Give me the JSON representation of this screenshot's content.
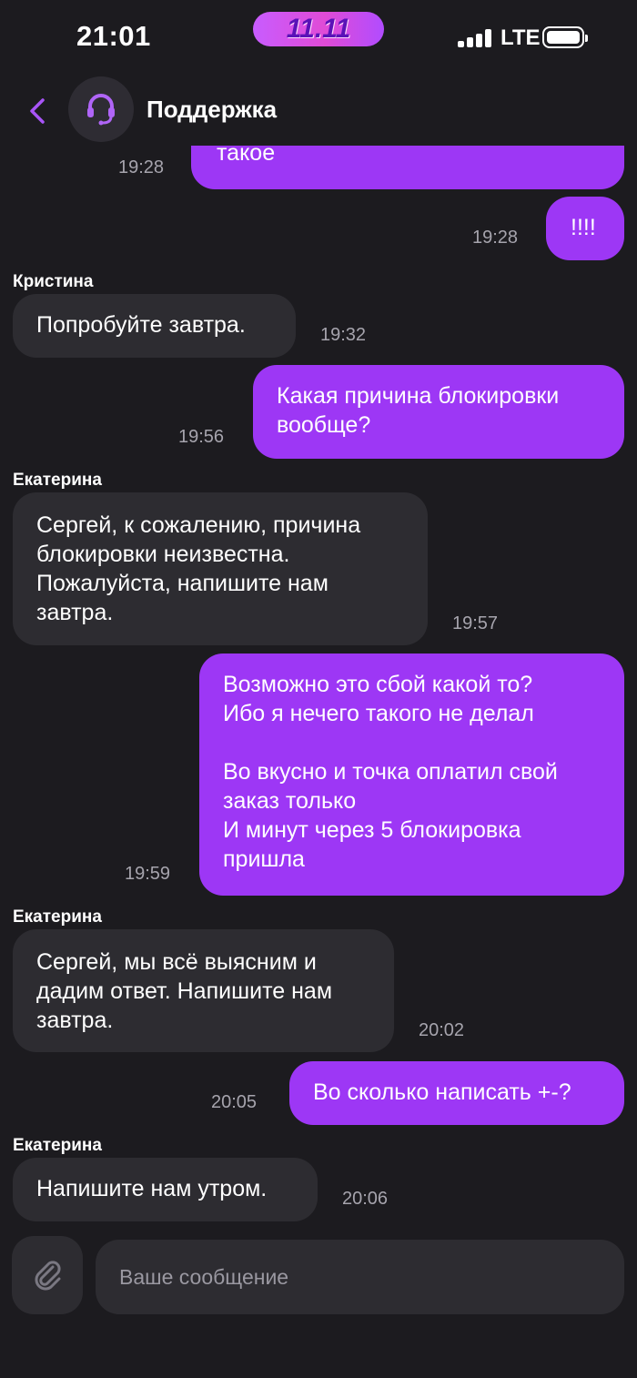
{
  "status_bar": {
    "time": "21:01",
    "promo_badge": "11.11",
    "network": "LTE"
  },
  "header": {
    "title": "Поддержка"
  },
  "messages": [
    {
      "direction": "out",
      "text": "такое",
      "time": "19:28"
    },
    {
      "direction": "out",
      "text": "!!!!",
      "time": "19:28"
    },
    {
      "direction": "in",
      "sender": "Кристина",
      "text": "Попробуйте завтра.",
      "time": "19:32"
    },
    {
      "direction": "out",
      "text": "Какая причина блокировки\nвообще?",
      "time": "19:56"
    },
    {
      "direction": "in",
      "sender": "Екатерина",
      "text": "Сергей, к сожалению, причина\nблокировки неизвестна.\nПожалуйста, напишите нам\nзавтра.",
      "time": "19:57"
    },
    {
      "direction": "out",
      "text": "Возможно это сбой какой то?\nИбо я нечего такого не делал\n\nВо вкусно и точка оплатил свой\nзаказ только\nИ минут через 5 блокировка\nпришла",
      "time": "19:59"
    },
    {
      "direction": "in",
      "sender": "Екатерина",
      "text": "Сергей, мы всё выясним и\nдадим ответ. Напишите нам\nзавтра.",
      "time": "20:02"
    },
    {
      "direction": "out",
      "text": "Во сколько написать +-?",
      "time": "20:05"
    },
    {
      "direction": "in",
      "sender": "Екатерина",
      "text": "Напишите нам утром.",
      "time": "20:06"
    }
  ],
  "composer": {
    "placeholder": "Ваше сообщение"
  },
  "colors": {
    "background": "#1c1b1f",
    "outgoing_bubble": "#9d37f5",
    "incoming_bubble": "#2d2c31",
    "accent": "#a855f7",
    "timestamp": "#a6a4ad"
  },
  "icons": {
    "back": "chevron-left-icon",
    "avatar": "headset-icon",
    "attach": "paperclip-icon"
  }
}
